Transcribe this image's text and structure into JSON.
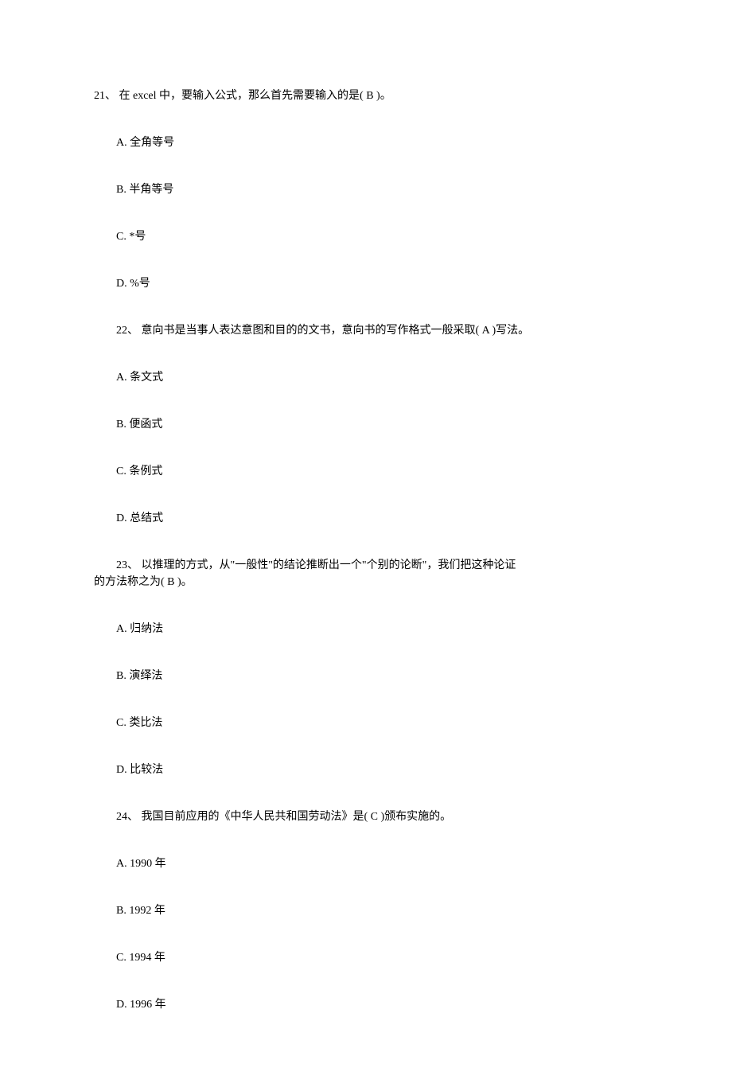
{
  "questions": [
    {
      "number": "21、 在 excel 中，要输入公式，那么首先需要输入的是( B )。",
      "options": [
        "A. 全角等号",
        "B. 半角等号",
        "C. *号",
        "D. %号"
      ]
    },
    {
      "number": "22、 意向书是当事人表达意图和目的的文书，意向书的写作格式一般采取( A )写法。",
      "options": [
        "A. 条文式",
        "B. 便函式",
        "C. 条例式",
        "D. 总结式"
      ]
    },
    {
      "number_line1": "23、 以推理的方式，从\"一般性\"的结论推断出一个\"个别的论断\"，我们把这种论证",
      "number_line2": "的方法称之为( B )。",
      "options": [
        "A. 归纳法",
        "B. 演绎法",
        "C. 类比法",
        "D. 比较法"
      ]
    },
    {
      "number": "24、 我国目前应用的《中华人民共和国劳动法》是( C )颁布实施的。",
      "options": [
        "A. 1990 年",
        "B. 1992 年",
        "C. 1994 年",
        "D. 1996 年"
      ]
    }
  ]
}
